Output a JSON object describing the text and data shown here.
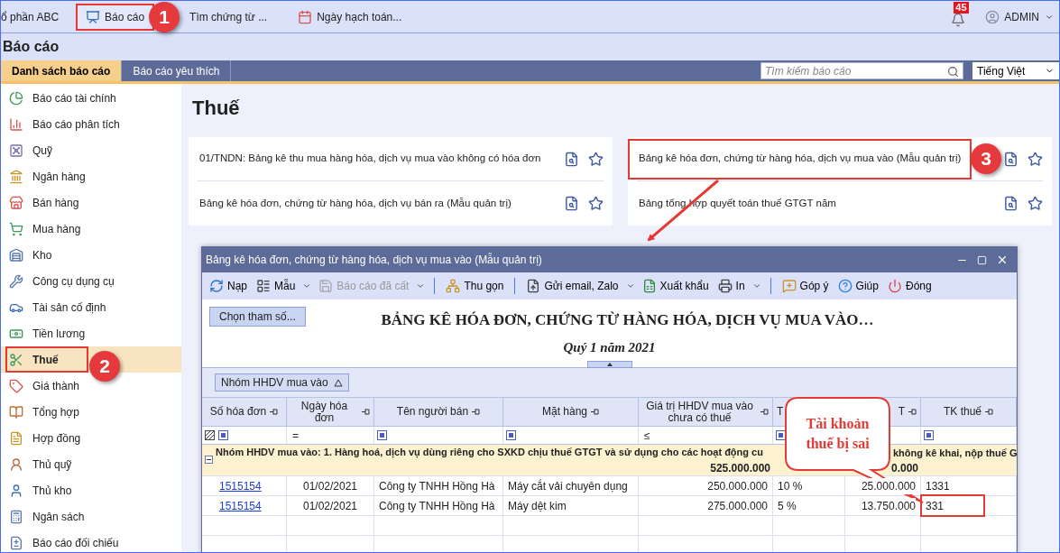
{
  "top_bar": {
    "company": "ổ phần ABC",
    "menu": [
      {
        "label": "Báo cáo",
        "selected": true
      },
      {
        "label": "Tìm chứng từ ...",
        "selected": false
      },
      {
        "label": "Ngày hạch toán...",
        "selected": false
      }
    ],
    "notification_count": "45",
    "user": "ADMIN"
  },
  "page_title": "Báo cáo",
  "tabs": [
    {
      "label": "Danh sách báo cáo",
      "selected": true
    },
    {
      "label": "Báo cáo yêu thích",
      "selected": false
    }
  ],
  "search": {
    "placeholder": "Tìm kiếm báo cáo"
  },
  "language": "Tiếng Việt",
  "sidebar": {
    "items": [
      {
        "label": "Báo cáo tài chính",
        "selected": false
      },
      {
        "label": "Báo cáo phân tích",
        "selected": false
      },
      {
        "label": "Quỹ",
        "selected": false
      },
      {
        "label": "Ngân hàng",
        "selected": false
      },
      {
        "label": "Bán hàng",
        "selected": false
      },
      {
        "label": "Mua hàng",
        "selected": false
      },
      {
        "label": "Kho",
        "selected": false
      },
      {
        "label": "Công cụ dụng cụ",
        "selected": false
      },
      {
        "label": "Tài sản cố định",
        "selected": false
      },
      {
        "label": "Tiền lương",
        "selected": false
      },
      {
        "label": "Thuế",
        "selected": true
      },
      {
        "label": "Giá thành",
        "selected": false
      },
      {
        "label": "Tổng hợp",
        "selected": false
      },
      {
        "label": "Hợp đồng",
        "selected": false
      },
      {
        "label": "Thủ quỹ",
        "selected": false
      },
      {
        "label": "Thủ kho",
        "selected": false
      },
      {
        "label": "Ngân sách",
        "selected": false
      },
      {
        "label": "Báo cáo đối chiếu",
        "selected": false
      }
    ]
  },
  "section_title": "Thuế",
  "reports": [
    {
      "label": "01/TNDN: Bảng kê thu mua hàng hóa, dịch vụ mua vào không có hóa đơn",
      "highlighted": false
    },
    {
      "label": "Bảng kê hóa đơn, chứng từ hàng hóa, dịch vụ mua vào (Mẫu quản trị)",
      "highlighted": true
    },
    {
      "label": "Bảng kê hóa đơn, chứng từ hàng hóa, dịch vụ bán ra (Mẫu quản trị)",
      "highlighted": false
    },
    {
      "label": "Bảng tổng hợp quyết toán thuế GTGT năm",
      "highlighted": false
    }
  ],
  "dialog": {
    "title": "Bảng kê hóa đơn, chứng từ hàng hóa, dịch vụ mua vào (Mẫu quản trị)",
    "toolbar": [
      {
        "label": "Nạp",
        "dropdown": false,
        "disabled": false
      },
      {
        "label": "Mẫu",
        "dropdown": true,
        "disabled": false
      },
      {
        "label": "Báo cáo đã cất",
        "dropdown": true,
        "disabled": true
      },
      {
        "label": "Thu gọn",
        "dropdown": false,
        "disabled": false
      },
      {
        "label": "Gửi email, Zalo",
        "dropdown": true,
        "disabled": false
      },
      {
        "label": "Xuất khẩu",
        "dropdown": false,
        "disabled": false
      },
      {
        "label": "In",
        "dropdown": true,
        "disabled": false
      },
      {
        "label": "Góp ý",
        "dropdown": false,
        "disabled": false
      },
      {
        "label": "Giúp",
        "dropdown": false,
        "disabled": false
      },
      {
        "label": "Đóng",
        "dropdown": false,
        "disabled": false
      }
    ],
    "params_button": "Chọn tham số...",
    "report_title": "BẢNG KÊ HÓA ĐƠN, CHỨNG TỪ HÀNG HÓA, DỊCH VỤ MUA VÀO…",
    "report_subtitle": "Quý 1 năm 2021",
    "group_chip": "Nhóm HHDV mua vào",
    "columns": [
      {
        "label": "Số hóa đơn",
        "filter": {
          "kind": "square"
        }
      },
      {
        "label": "Ngày hóa đơn",
        "filter": {
          "kind": "operator",
          "text": "="
        }
      },
      {
        "label": "Tên người bán",
        "filter": {
          "kind": "square"
        }
      },
      {
        "label": "Mặt hàng",
        "filter": {
          "kind": "square"
        }
      },
      {
        "label": "Giá trị HHDV mua vào chưa có thuế",
        "filter": {
          "kind": "operator",
          "text": "≤"
        }
      },
      {
        "label": "T",
        "filter": {
          "kind": "square"
        }
      },
      {
        "label": "T"
      },
      {
        "label": "TK thuế",
        "filter": {
          "kind": "square"
        }
      }
    ],
    "group_row": {
      "expanded": true,
      "label": "Nhóm HHDV mua vào: 1. Hàng hoá, dịch vụ dùng riêng cho SXKD chịu thuế GTGT và sử dụng cho các hoạt động cu",
      "label_tail": "không kê khai, nộp thuế G",
      "total": "525.000.000",
      "total_tail": "0.000"
    },
    "rows": [
      {
        "cells": [
          "1515154",
          "01/02/2021",
          "Công ty TNHH Hồng Hà",
          "Máy cắt vải chuyên dụng",
          "250.000.000",
          "10 %",
          "25.000.000",
          "1331"
        ]
      },
      {
        "cells": [
          "1515154",
          "01/02/2021",
          "Công ty TNHH Hồng Hà",
          "Máy dệt kim",
          "275.000.000",
          "5 %",
          "13.750.000",
          "331"
        ]
      }
    ]
  },
  "annotations": {
    "steps": [
      "1",
      "2",
      "3"
    ],
    "callout": "Tài khoản thuế bị sai"
  }
}
